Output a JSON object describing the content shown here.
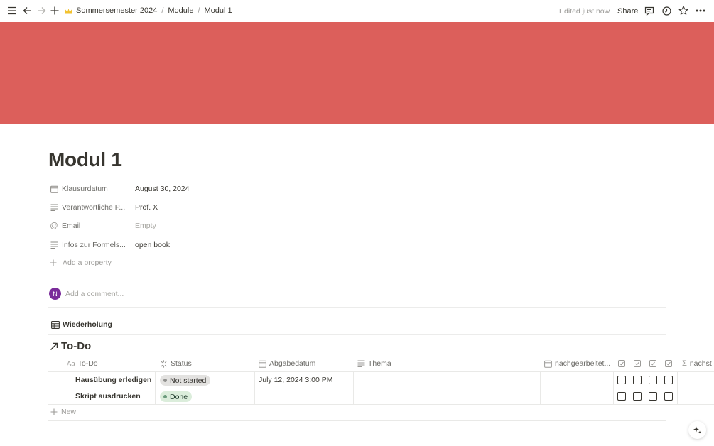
{
  "topbar": {
    "breadcrumb": [
      {
        "label": "Sommersemester 2024"
      },
      {
        "label": "Module"
      },
      {
        "label": "Modul 1"
      }
    ],
    "separator": "/",
    "edited": "Edited just now",
    "share": "Share"
  },
  "colors": {
    "cover": "#dc5f5b",
    "avatar": "#7a2b9a",
    "status_not_started_bg": "#e3e2e0",
    "status_done_bg": "#dbeddb"
  },
  "page": {
    "title": "Modul 1",
    "properties": [
      {
        "icon": "calendar-icon",
        "name": "Klausurdatum",
        "value": "August 30, 2024"
      },
      {
        "icon": "text-lines-icon",
        "name": "Verantwortliche P...",
        "value": "Prof. X"
      },
      {
        "icon": "at-sign-icon",
        "name": "Email",
        "value": "Empty"
      },
      {
        "icon": "text-lines-icon",
        "name": "Infos zur Formels...",
        "value": "open book"
      }
    ],
    "add_property": "Add a property",
    "avatar_initial": "N",
    "comment_placeholder": "Add a comment...",
    "view_tab": "Wiederholung"
  },
  "database": {
    "title": "To-Do",
    "columns": {
      "todo": "To-Do",
      "todo_icon": "Aa",
      "status": "Status",
      "abgabedatum": "Abgabedatum",
      "thema": "Thema",
      "nachgearbeitet": "nachgearbeitet...",
      "naechste": "nächst"
    },
    "rows": [
      {
        "todo": "Hausübung erledigen",
        "status": "Not started",
        "abgabedatum": "July 12, 2024 3:00 PM",
        "checks": [
          false,
          false,
          false,
          false
        ]
      },
      {
        "todo": "Skript ausdrucken",
        "status": "Done",
        "abgabedatum": "",
        "checks": [
          false,
          false,
          false,
          false
        ]
      }
    ],
    "new_label": "New"
  }
}
